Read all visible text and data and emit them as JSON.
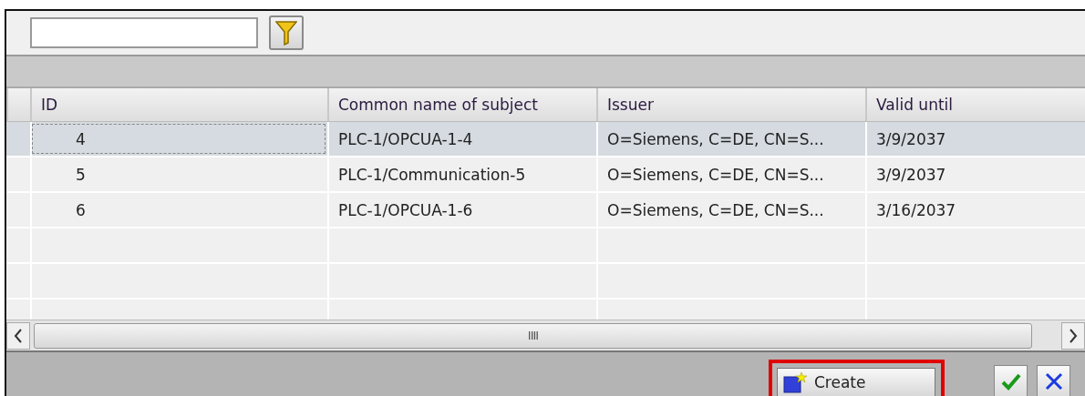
{
  "table": {
    "columns": [
      "ID",
      "Common name of subject",
      "Issuer",
      "Valid until"
    ],
    "rows": [
      {
        "selected": true,
        "cells": [
          "4",
          "PLC-1/OPCUA-1-4",
          "O=Siemens, C=DE, CN=S...",
          "3/9/2037"
        ]
      },
      {
        "selected": false,
        "cells": [
          "5",
          "PLC-1/Communication-5",
          "O=Siemens, C=DE, CN=S...",
          "3/9/2037"
        ]
      },
      {
        "selected": false,
        "cells": [
          "6",
          "PLC-1/OPCUA-1-6",
          "O=Siemens, C=DE, CN=S...",
          "3/16/2037"
        ]
      }
    ]
  },
  "scrollbar_grip": "IIII",
  "footer": {
    "create_button": {
      "label": "Create",
      "highlighted": true
    }
  }
}
